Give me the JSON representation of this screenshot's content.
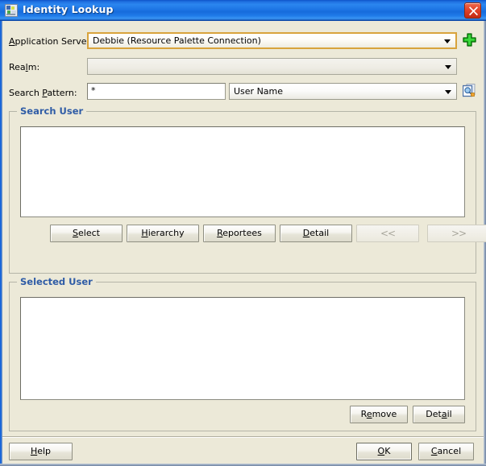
{
  "window": {
    "title": "Identity Lookup",
    "icon": "app-window-icon",
    "close_icon": "close-icon",
    "titlebar_color": "#1d74e4",
    "close_button_color": "#e2432a",
    "background_color": "#ece9d8"
  },
  "form": {
    "application_server": {
      "label_pre": "A",
      "label_mnemonic": "A",
      "label": "Application Server:",
      "value": "Debbie (Resource Palette Connection)",
      "focused": true,
      "add_icon": "green-plus-icon"
    },
    "realm": {
      "label": "Realm:",
      "value": "",
      "focused": false
    },
    "search_pattern": {
      "label": "Search Pattern:",
      "value": "*",
      "attribute_value": "User Name",
      "search_icon": "search-document-icon"
    }
  },
  "search_user": {
    "title": "Search User",
    "results": [],
    "buttons": [
      {
        "name": "select",
        "label": "Select",
        "mnemonic": "S",
        "enabled": true
      },
      {
        "name": "hierarchy",
        "label": "Hierarchy",
        "mnemonic": "H",
        "enabled": true
      },
      {
        "name": "reportees",
        "label": "Reportees",
        "mnemonic": "R",
        "enabled": true
      },
      {
        "name": "detail",
        "label": "Detail",
        "mnemonic": "D",
        "enabled": true
      },
      {
        "name": "previous",
        "label": "<<",
        "mnemonic": "",
        "enabled": false
      },
      {
        "name": "next",
        "label": ">>",
        "mnemonic": "",
        "enabled": false
      }
    ]
  },
  "selected_user": {
    "title": "Selected User",
    "items": [],
    "buttons": [
      {
        "name": "remove",
        "label": "Remove",
        "mnemonic": "e",
        "enabled": true
      },
      {
        "name": "detail",
        "label": "Detail",
        "mnemonic": "a",
        "enabled": true
      }
    ]
  },
  "footer": {
    "help": {
      "label": "Help",
      "mnemonic": "H"
    },
    "ok": {
      "label": "OK",
      "mnemonic": "O",
      "default": true
    },
    "cancel": {
      "label": "Cancel",
      "mnemonic": "C"
    }
  }
}
